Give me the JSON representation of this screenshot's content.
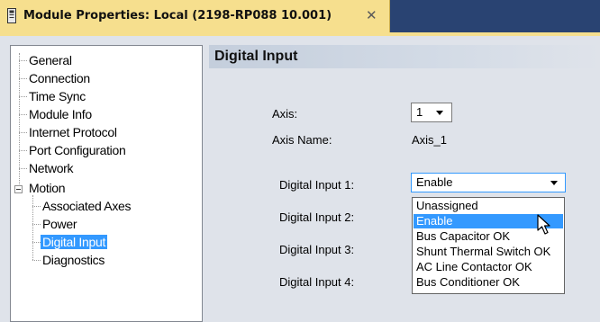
{
  "window": {
    "tab_title": "Module Properties: Local (2198-RP088 10.001)",
    "tab_close_glyph": "✕",
    "colors": {
      "tab_background": "#f6df8e",
      "tabstrip_background": "#294372",
      "selection": "#3399ff",
      "panel_background": "#dfe3ea"
    }
  },
  "tree": {
    "items": [
      {
        "label": "General"
      },
      {
        "label": "Connection"
      },
      {
        "label": "Time Sync"
      },
      {
        "label": "Module Info"
      },
      {
        "label": "Internet Protocol"
      },
      {
        "label": "Port Configuration"
      },
      {
        "label": "Network"
      },
      {
        "label": "Motion",
        "expanded": true
      },
      {
        "label": "Associated Axes"
      },
      {
        "label": "Power"
      },
      {
        "label": "Digital Input",
        "selected": true
      },
      {
        "label": "Diagnostics"
      }
    ]
  },
  "main": {
    "section_title": "Digital Input",
    "axis": {
      "label": "Axis:",
      "value": "1"
    },
    "axis_name": {
      "label": "Axis Name:",
      "value": "Axis_1"
    },
    "inputs": [
      {
        "label": "Digital Input 1:",
        "value": "Enable",
        "open": true
      },
      {
        "label": "Digital Input 2:"
      },
      {
        "label": "Digital Input 3:"
      },
      {
        "label": "Digital Input 4:"
      }
    ],
    "dropdown_options": [
      "Unassigned",
      "Enable",
      "Bus Capacitor OK",
      "Shunt Thermal Switch OK",
      "AC Line Contactor OK",
      "Bus Conditioner OK"
    ],
    "dropdown_selected": "Enable"
  },
  "icons": {
    "tab_icon": "module-icon",
    "tab_close": "close-icon",
    "tree_expander": "collapse-minus-icon",
    "dropdown_arrow": "chevron-down-icon",
    "pointer": "mouse-cursor-icon"
  }
}
